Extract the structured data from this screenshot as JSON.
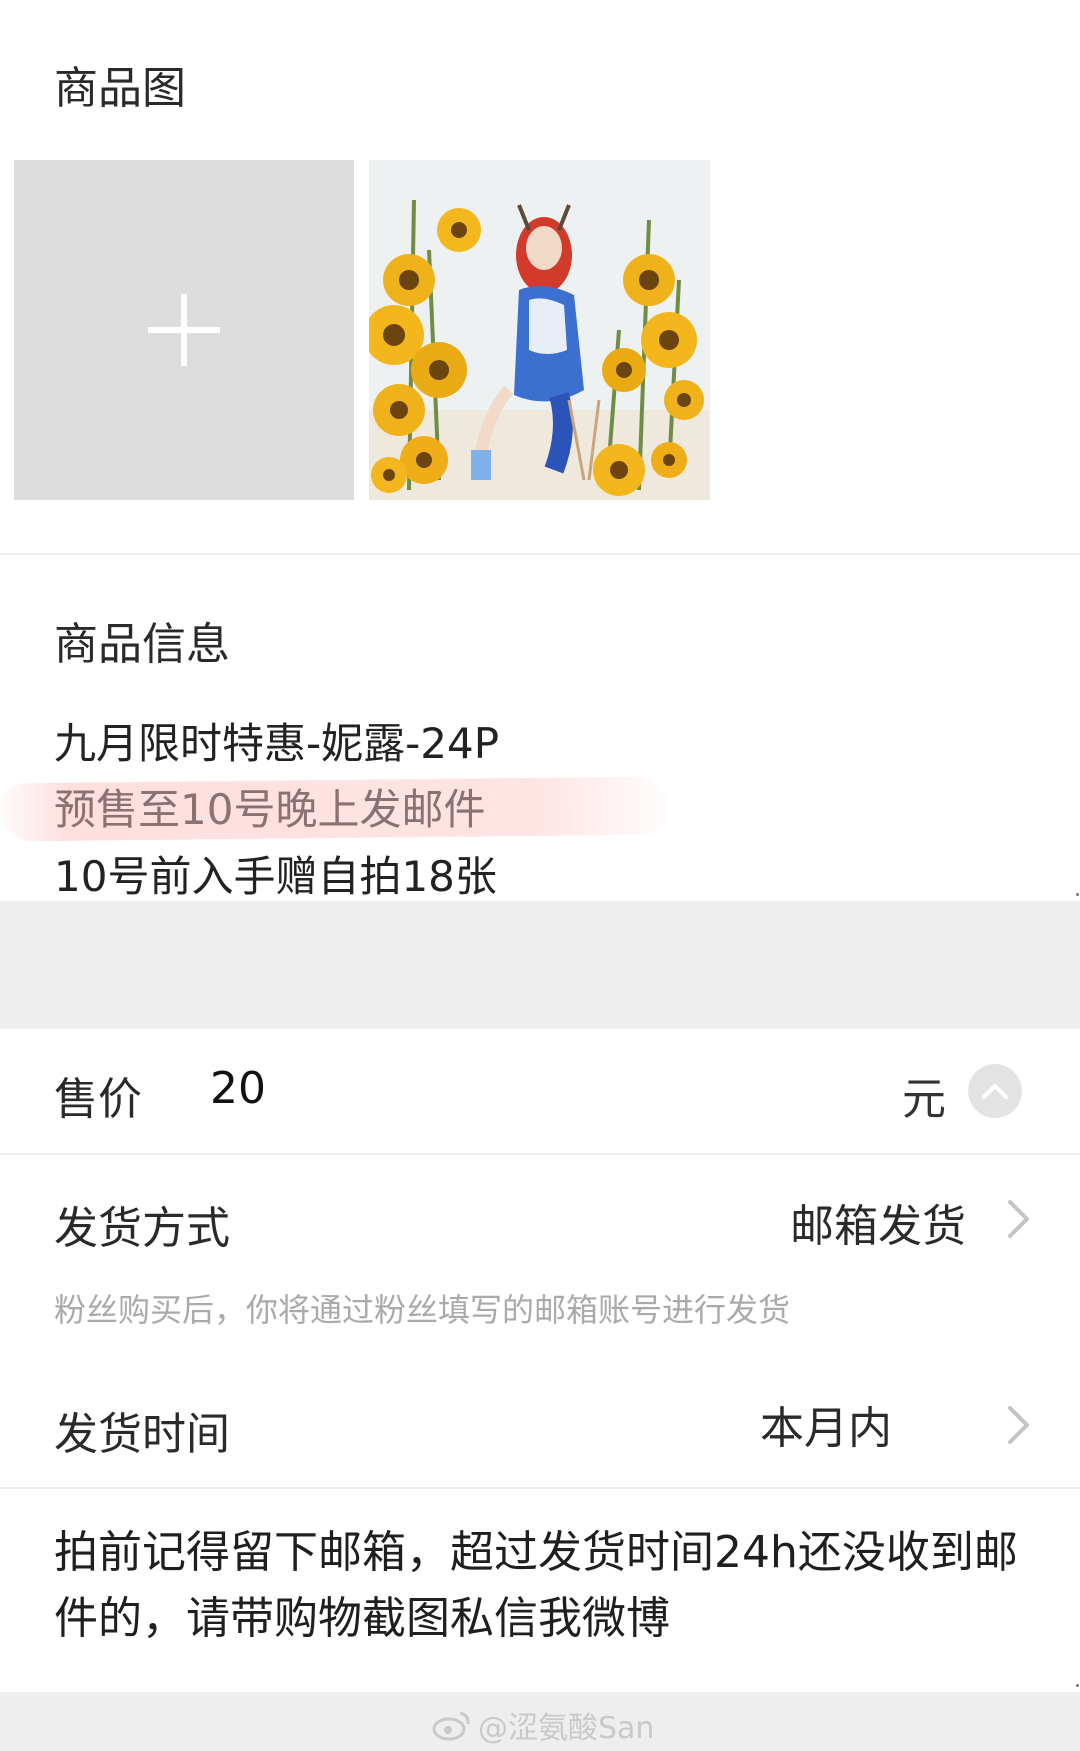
{
  "images_section": {
    "title": "商品图",
    "add_button_icon": "plus-icon",
    "photo_alt": "product-photo"
  },
  "info_section": {
    "title": "商品信息",
    "lines": [
      "九月限时特惠-妮露-24P",
      "预售至10号晚上发邮件",
      "10号前入手赠自拍18张"
    ]
  },
  "price": {
    "label": "售价",
    "value": "20",
    "unit": "元"
  },
  "shipping_method": {
    "label": "发货方式",
    "value": "邮箱发货",
    "hint": "粉丝购买后，你将通过粉丝填写的邮箱账号进行发货"
  },
  "shipping_time": {
    "label": "发货时间",
    "value": "本月内"
  },
  "notes": {
    "text": "拍前记得留下邮箱，超过发货时间24h还没收到邮件的，请带购物截图私信我微博"
  },
  "watermark": {
    "text": "@涩氨酸San"
  },
  "colors": {
    "highlight": "#ffd0d0",
    "band": "#eeeeee",
    "tile": "#dcdcdc"
  }
}
